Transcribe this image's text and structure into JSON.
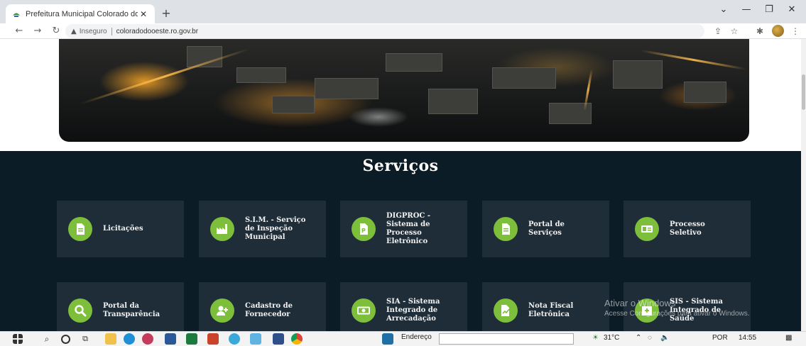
{
  "browser": {
    "tab_title": "Prefeitura Municipal Colorado do",
    "tab_close": "✕",
    "new_tab": "+",
    "security_label": "Inseguro",
    "url": "coloradodooeste.ro.gov.br"
  },
  "page": {
    "section_title": "Serviços",
    "accent_color": "#7dbf3a",
    "services": [
      {
        "label": "Licitações",
        "icon": "document-icon"
      },
      {
        "label": "S.I.M. - Serviço de Inspeção Municipal",
        "icon": "factory-icon"
      },
      {
        "label": "DIGPROC - Sistema de Processo Eletrônico",
        "icon": "pdf-document-icon"
      },
      {
        "label": "Portal de Serviços",
        "icon": "document-icon"
      },
      {
        "label": "Processo Seletivo",
        "icon": "id-card-icon"
      },
      {
        "label": "Portal da Transparência",
        "icon": "search-icon"
      },
      {
        "label": "Cadastro de Fornecedor",
        "icon": "add-user-icon"
      },
      {
        "label": "SIA - Sistema Integrado de Arrecadação",
        "icon": "money-icon"
      },
      {
        "label": "Nota Fiscal Eletrônica",
        "icon": "signed-document-icon"
      },
      {
        "label": "SIS - Sistema Integrado de Saúde",
        "icon": "hospital-icon"
      }
    ]
  },
  "watermark": {
    "line1": "Ativar o Windows",
    "line2": "Acesse Configurações para ativar o Windows."
  },
  "taskbar": {
    "address_label": "Endereço",
    "temperature": "31°C",
    "language": "POR",
    "time": "14:55"
  }
}
